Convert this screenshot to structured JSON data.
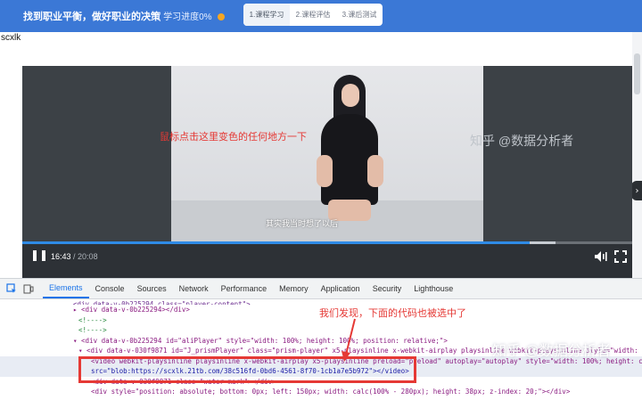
{
  "header": {
    "course_title": "找到职业平衡，做好职业的决策",
    "progress_text": "( 学习进度0% ",
    "steps": [
      {
        "label": "1.课程学习"
      },
      {
        "label": "2.课程评估"
      },
      {
        "label": "3.课后测试"
      }
    ]
  },
  "site_tag": "scxlk",
  "player": {
    "overlay_message": "鼠标点击这里变色的任何地方一下",
    "subtitle": "其实我当时想了以后",
    "watermark": "知乎 @数据分析者",
    "current_time": "16:43",
    "duration": "/ 20:08",
    "progress_fraction": 0.832
  },
  "devtools": {
    "tabs": [
      "Elements",
      "Console",
      "Sources",
      "Network",
      "Performance",
      "Memory",
      "Application",
      "Security",
      "Lighthouse"
    ],
    "annotation": "我们发现，下面的代码也被选中了",
    "lines": [
      "<div data-v-0b225294 class=\"player-content\">",
      "<div data-v-0b225294></div>",
      "<!---->",
      "<!---->",
      "<div data-v-0b225294 id=\"aliPlayer\" style=\"width: 100%; height: 100%; position: relative;\">",
      "<div data-v-030f9871 id=\"J_prismPlayer\" class=\"prism-player\" x5-playsinline x-webkit-airplay playsinline webkit-playsinline style=\"width: 100%; heig",
      "<video webkit-playsinline playsinline x-webkit-airplay x5-playsinline preload=\"preload\" autoplay=\"autoplay\" style=\"width: 100%; height: calc(100%",
      "src=\"blob:https://scxlk.21tb.com/38c516fd-0bd6-4561-8f70-1cb1a7e5b972\"></video>",
      "<div data-v-030f9871 class=\"water-mark\"></div>",
      "<div style=\"position: absolute; bottom: 0px; left: 150px; width: calc(100% - 280px); height: 38px; z-index: 20;\"></div>"
    ]
  },
  "colors": {
    "header_bg": "#3b78d6",
    "annotation_red": "#e53935",
    "accent_blue": "#1a73e8"
  }
}
